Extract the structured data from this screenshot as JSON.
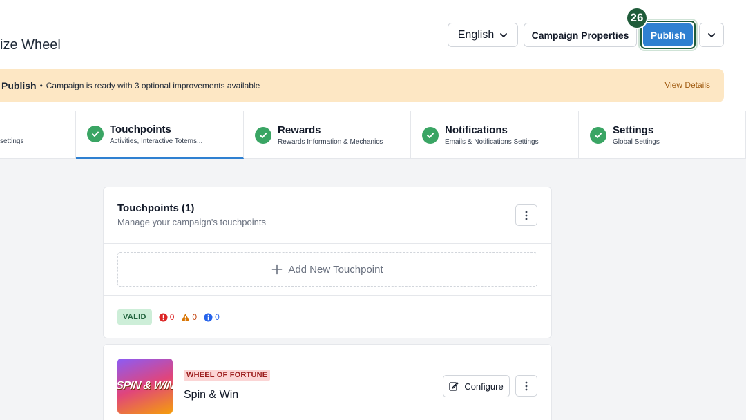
{
  "header": {
    "page_title": "ize Wheel",
    "language": "English",
    "campaign_properties_label": "Campaign Properties",
    "publish_label": "Publish",
    "step_badge": "26"
  },
  "banner": {
    "title": "Publish",
    "separator": "•",
    "message": "Campaign is ready with 3 optional improvements available",
    "link": "View Details"
  },
  "tabs": [
    {
      "title": "",
      "subtitle": "settings"
    },
    {
      "title": "Touchpoints",
      "subtitle": "Activities, Interactive Totems...",
      "active": true
    },
    {
      "title": "Rewards",
      "subtitle": "Rewards Information & Mechanics"
    },
    {
      "title": "Notifications",
      "subtitle": "Emails & Notifications Settings"
    },
    {
      "title": "Settings",
      "subtitle": "Global Settings"
    }
  ],
  "touchpoints_card": {
    "title": "Touchpoints (1)",
    "subtitle": "Manage your campaign's touchpoints",
    "add_label": "Add New Touchpoint",
    "status_label": "VALID",
    "errors": "0",
    "warnings": "0",
    "infos": "0"
  },
  "touchpoint_item": {
    "thumbnail_text": "SPIN & WIN",
    "type_label": "WHEEL OF FORTUNE",
    "name": "Spin & Win",
    "configure_label": "Configure"
  },
  "colors": {
    "primary": "#2f80d1",
    "success": "#3aa564",
    "badge_green": "#1f5c3a",
    "banner_bg": "#fde7c4",
    "link_orange": "#a15c12"
  }
}
